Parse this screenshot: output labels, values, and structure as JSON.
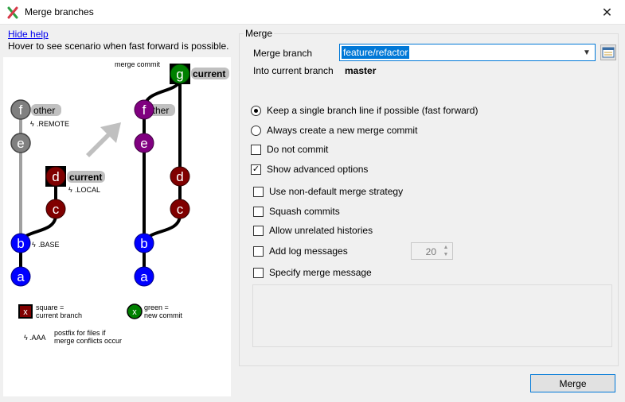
{
  "window": {
    "title": "Merge branches",
    "close_glyph": "✕"
  },
  "help": {
    "hide_link": "Hide help",
    "hover_text": "Hover to see scenario when fast forward is possible."
  },
  "diagram": {
    "merge_commit_label": "merge commit",
    "before": {
      "other_label": "other",
      "remote_suffix": ".REMOTE",
      "current_label": "current",
      "local_suffix": ".LOCAL",
      "base_suffix": ".BASE",
      "nodes": {
        "f": "f",
        "e": "e",
        "d": "d",
        "c": "c",
        "b": "b",
        "a": "a"
      }
    },
    "after": {
      "current_label": "current",
      "other_label": "other",
      "nodes": {
        "g": "g",
        "f": "f",
        "e": "e",
        "d": "d",
        "c": "c",
        "b": "b",
        "a": "a"
      }
    },
    "legend": {
      "square_glyph": "x",
      "square_text_1": "square =",
      "square_text_2": "current branch",
      "green_glyph": "x",
      "green_text_1": "green =",
      "green_text_2": "new commit",
      "postfix_code": ".AAA",
      "postfix_text_1": "postfix for files if",
      "postfix_text_2": "merge conflicts occur"
    },
    "colors": {
      "gray": "#808080",
      "purple": "#800080",
      "darkred": "#800000",
      "blue": "#0000ff",
      "green": "#008000",
      "arrow": "#c0c0c0"
    }
  },
  "merge": {
    "group_title": "Merge",
    "merge_branch_label": "Merge branch",
    "merge_branch_value": "feature/refactor",
    "into_label": "Into current branch",
    "into_value": "master",
    "options": {
      "fast_forward": {
        "label": "Keep a single branch line if possible (fast forward)",
        "checked": true
      },
      "always_merge": {
        "label": "Always create a new merge commit",
        "checked": false
      },
      "no_commit": {
        "label": "Do not commit",
        "checked": false
      },
      "advanced": {
        "label": "Show advanced options",
        "checked": true
      }
    },
    "advanced": {
      "strategy": {
        "label": "Use non-default merge strategy",
        "checked": false
      },
      "squash": {
        "label": "Squash commits",
        "checked": false
      },
      "unrelated": {
        "label": "Allow unrelated histories",
        "checked": false
      },
      "log": {
        "label": "Add log messages",
        "checked": false,
        "count": "20"
      },
      "message": {
        "label": "Specify merge message",
        "checked": false
      }
    },
    "merge_button": "Merge"
  }
}
